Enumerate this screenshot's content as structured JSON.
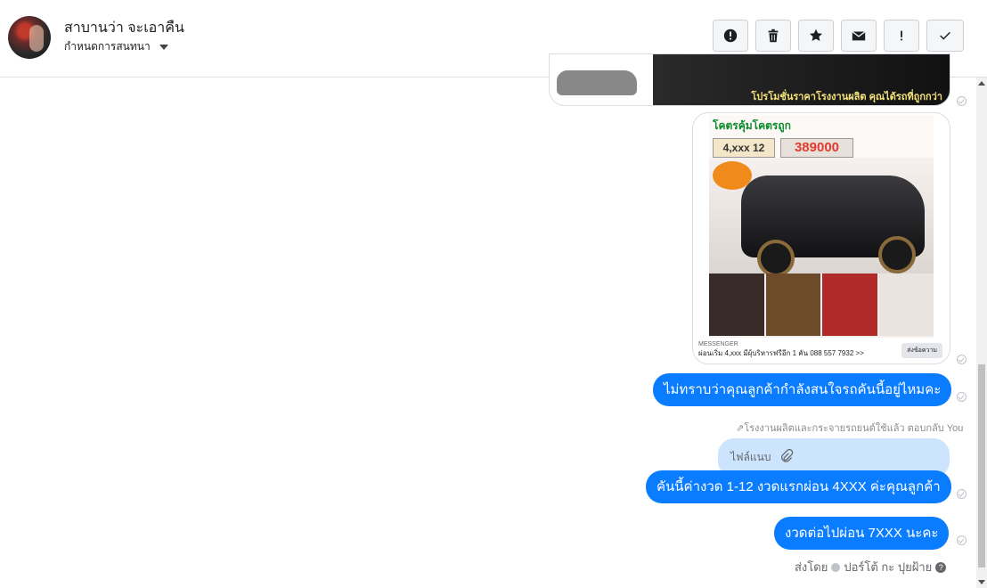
{
  "header": {
    "contact_name": "สาบานว่า จะเอาคืน",
    "assign_label": "กำหนดการสนทนา"
  },
  "toolbar": {
    "buttons": [
      {
        "icon": "alert-circle-icon"
      },
      {
        "icon": "trash-icon"
      },
      {
        "icon": "star-icon"
      },
      {
        "icon": "mail-icon"
      },
      {
        "icon": "exclamation-icon"
      },
      {
        "icon": "check-icon"
      }
    ]
  },
  "images": {
    "banner_text": "โปรโมชั่นราคาโรงงานผลิต คุณได้รถที่ถูกกว่า",
    "ad_title": "โคตรคุ้มโคตรถูก",
    "ad_installment": "4,xxx 12",
    "ad_price": "389000",
    "ad_footer_label": "MESSENGER",
    "ad_footer_text": "ผ่อนเริ่ม 4,xxx มีผุ้บริหารฟรีอีก 1 คัน 088 557 7932 >>",
    "ad_send_label": "ส่งข้อความ"
  },
  "messages": [
    {
      "text": "ไม่ทราบว่าคุณลูกค้ากำลังสนใจรถคันนี้อยู่ไหมคะ"
    },
    {
      "text": "คันนี้ค่างวด 1-12 งวดแรกผ่อน 4XXX ค่ะคุณลูกค้า"
    },
    {
      "text": "งวดต่อไปผ่อน 7XXX นะคะ"
    }
  ],
  "reply_note": "โรงงานผลิตและกระจายรถยนต์ใช้แล้ว ตอบกลับ You",
  "attachment_label": "ไฟล์แนบ",
  "sent_by": {
    "prefix": "ส่งโดย",
    "name": "ปอร์โต้ กะ ปุยฝ้าย"
  },
  "colors": {
    "bubble": "#0a7cff",
    "attachment_bg": "#cde4ff"
  }
}
